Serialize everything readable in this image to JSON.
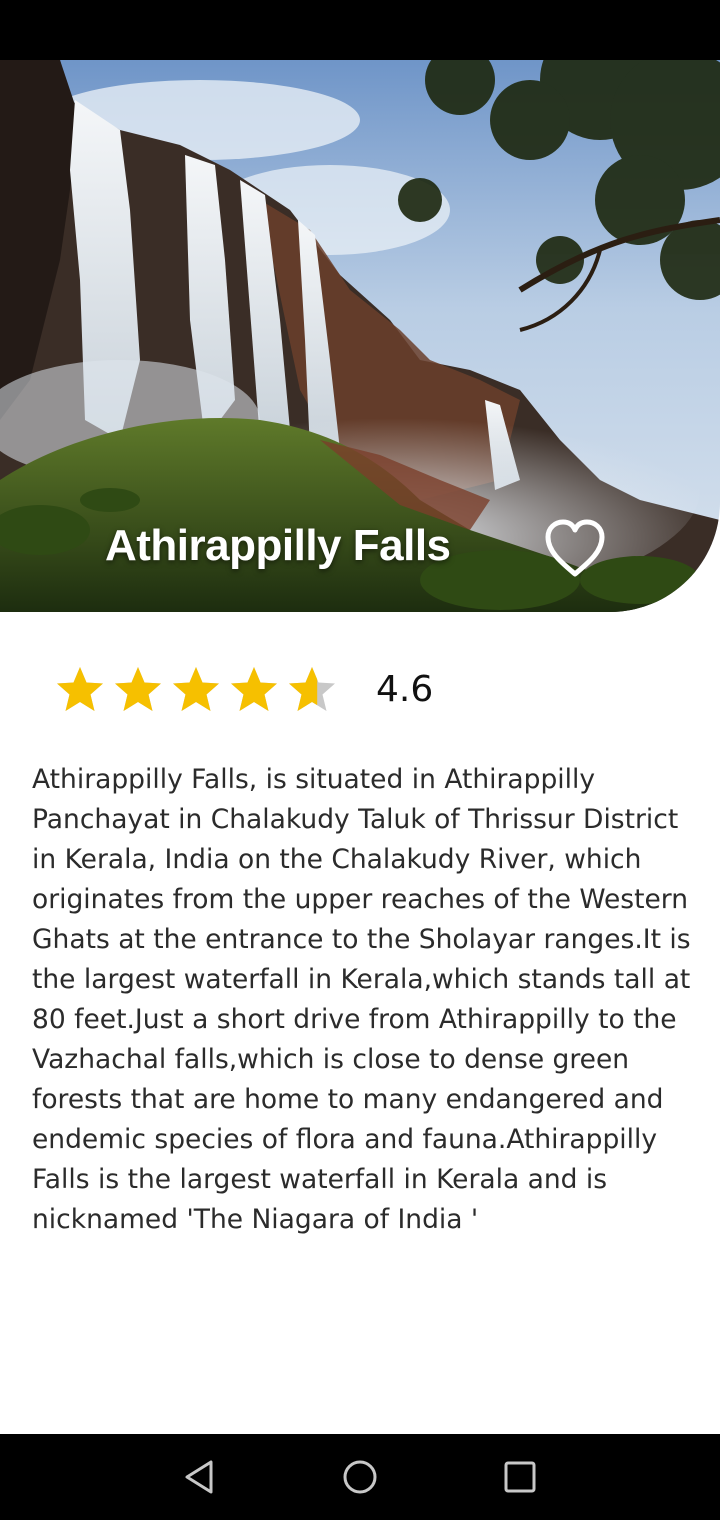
{
  "place": {
    "title": "Athirappilly Falls",
    "rating": 4.6,
    "rating_display": "4.6",
    "rating_max": 5,
    "favorite": false,
    "description": "Athirappilly Falls, is situated in Athirappilly Panchayat in Chalakudy Taluk of Thrissur District in Kerala, India on the Chalakudy River, which originates from the upper reaches of the Western Ghats at the entrance to the Sholayar ranges.It is the largest waterfall in Kerala,which stands tall at 80 feet.Just a short drive from Athirappilly to the Vazhachal falls,which is close to dense green forests that are home to many endangered and endemic species of flora and fauna.Athirappilly Falls is the largest waterfall in Kerala and is nicknamed 'The Niagara of India '"
  },
  "icons": {
    "favorite": "heart-outline-icon",
    "back": "triangle-back-icon",
    "home": "circle-home-icon",
    "recents": "square-recents-icon"
  },
  "colors": {
    "star_filled": "#F6C000",
    "star_empty": "#C8C8C8",
    "hero_title": "#FFFFFF",
    "system_bars": "#000000"
  }
}
